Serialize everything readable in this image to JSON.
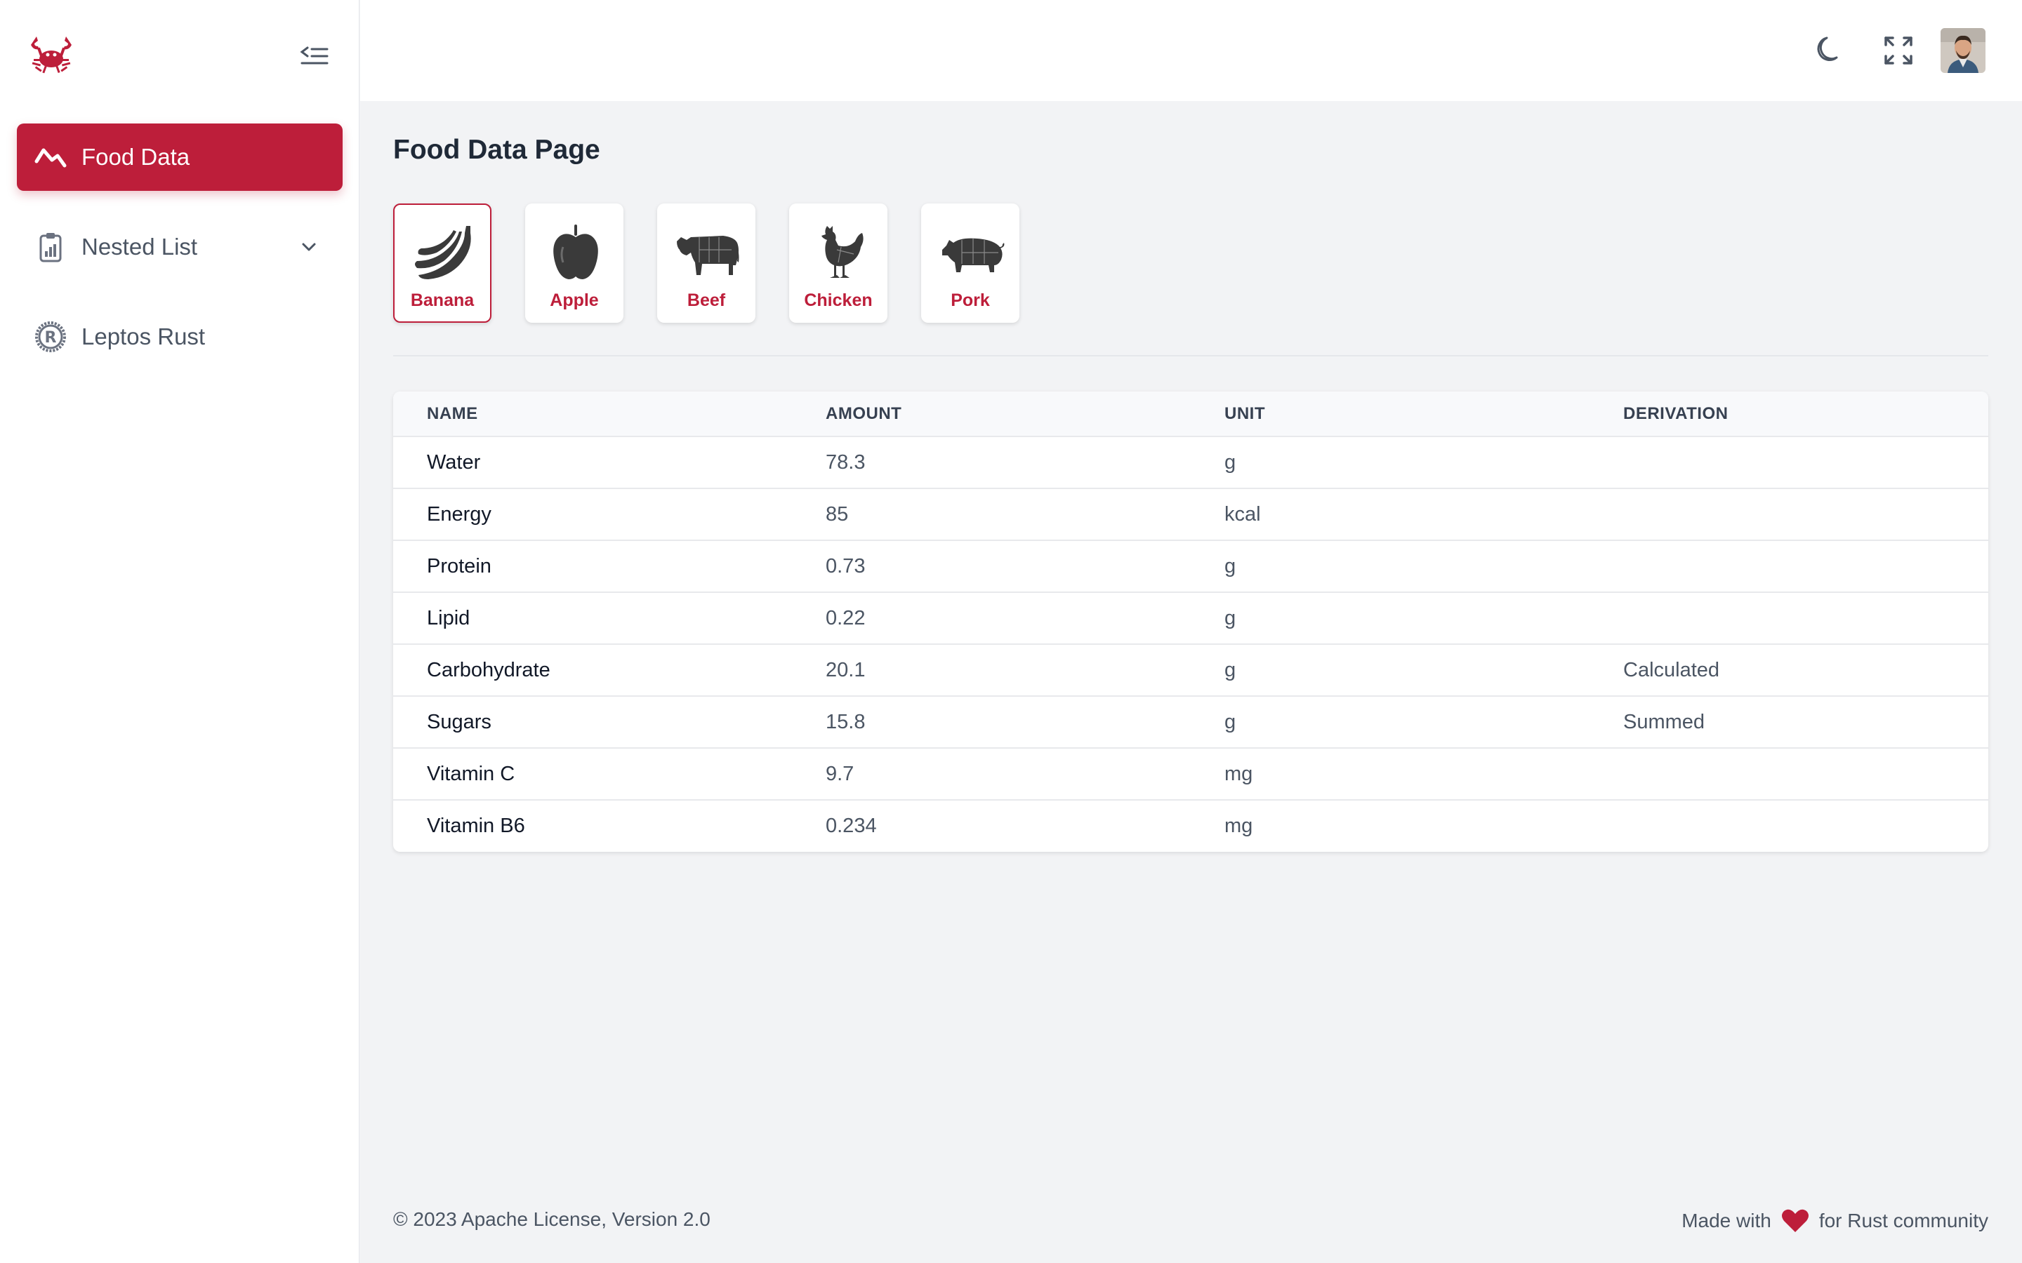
{
  "sidebar": {
    "items": [
      {
        "label": "Food Data",
        "icon": "activity-icon"
      },
      {
        "label": "Nested List",
        "icon": "clipboard-chart-icon"
      },
      {
        "label": "Leptos Rust",
        "icon": "rust-icon"
      }
    ]
  },
  "main": {
    "title": "Food Data Page",
    "foods": [
      {
        "label": "Banana",
        "icon": "banana-icon"
      },
      {
        "label": "Apple",
        "icon": "apple-icon"
      },
      {
        "label": "Beef",
        "icon": "cow-icon"
      },
      {
        "label": "Chicken",
        "icon": "chicken-icon"
      },
      {
        "label": "Pork",
        "icon": "pig-icon"
      }
    ],
    "selected_food": "Banana",
    "table": {
      "headers": [
        "NAME",
        "AMOUNT",
        "UNIT",
        "DERIVATION"
      ],
      "rows": [
        [
          "Water",
          "78.3",
          "g",
          ""
        ],
        [
          "Energy",
          "85",
          "kcal",
          ""
        ],
        [
          "Protein",
          "0.73",
          "g",
          ""
        ],
        [
          "Lipid",
          "0.22",
          "g",
          ""
        ],
        [
          "Carbohydrate",
          "20.1",
          "g",
          "Calculated"
        ],
        [
          "Sugars",
          "15.8",
          "g",
          "Summed"
        ],
        [
          "Vitamin C",
          "9.7",
          "mg",
          ""
        ],
        [
          "Vitamin B6",
          "0.234",
          "mg",
          ""
        ]
      ]
    }
  },
  "footer": {
    "copyright": "© 2023 Apache License, Version 2.0",
    "made_with": "Made with",
    "for_text": "for Rust community"
  },
  "colors": {
    "accent": "#bd1e3a",
    "background": "#f2f3f5"
  }
}
